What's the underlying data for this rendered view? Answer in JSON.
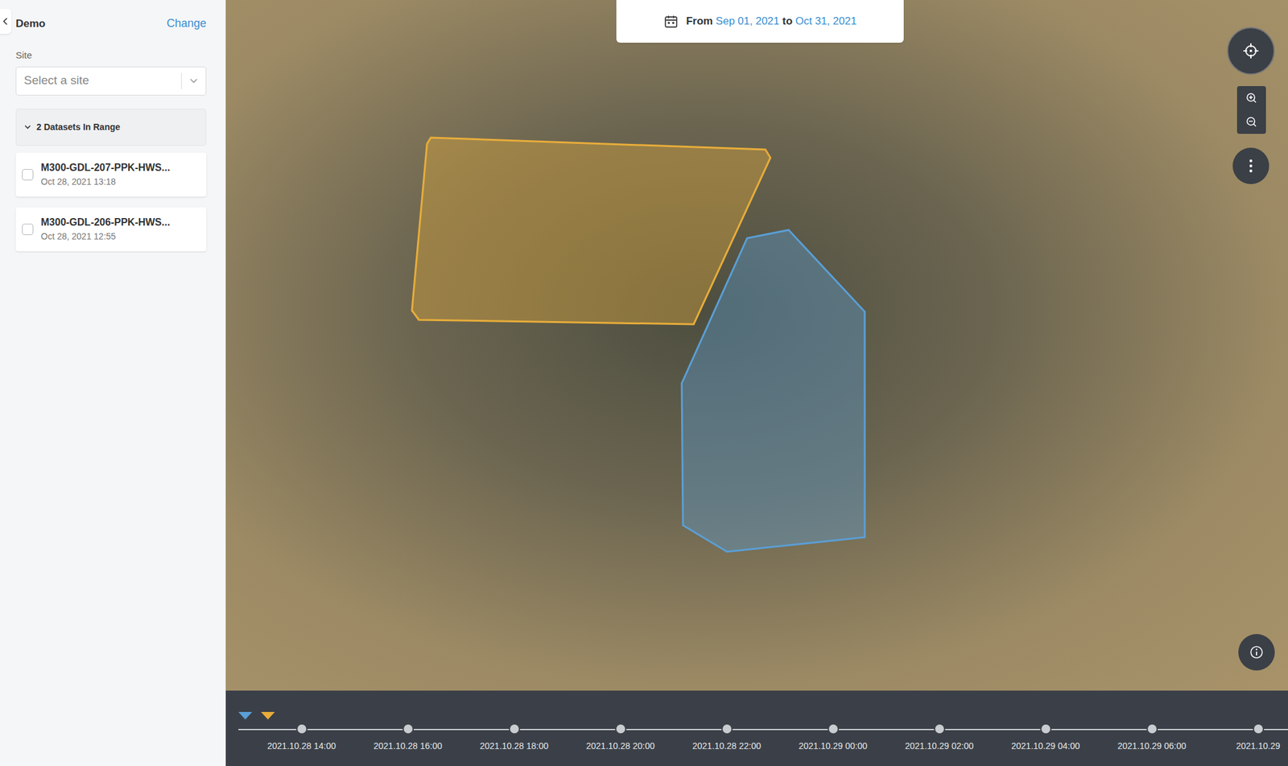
{
  "sidebar": {
    "project": "Demo",
    "change": "Change",
    "site_label": "Site",
    "site_placeholder": "Select a site",
    "datasets_header": "2 Datasets In Range",
    "datasets_expanded": true,
    "datasets": [
      {
        "name": "M300-GDL-207-PPK-HWS...",
        "date": "Oct 28, 2021 13:18",
        "checked": false,
        "color": "#e8ad3a"
      },
      {
        "name": "M300-GDL-206-PPK-HWS...",
        "date": "Oct 28, 2021 12:55",
        "checked": false,
        "color": "#5a9fd6"
      }
    ]
  },
  "date_range": {
    "prefix": "From",
    "start": "Sep 01, 2021",
    "connector": "to",
    "end": "Oct 31, 2021"
  },
  "timeline": {
    "ticks": [
      "2021.10.28 14:00",
      "2021.10.28 16:00",
      "2021.10.28 18:00",
      "2021.10.28 20:00",
      "2021.10.28 22:00",
      "2021.10.29 00:00",
      "2021.10.29 02:00",
      "2021.10.29 04:00",
      "2021.10.29 06:00",
      "2021.10.29"
    ]
  }
}
